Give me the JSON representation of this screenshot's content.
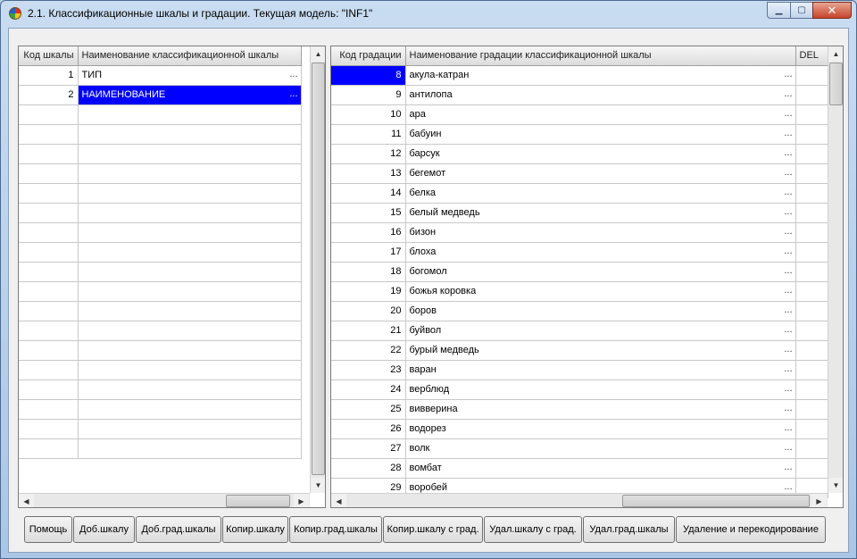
{
  "window": {
    "title": "2.1. Классификационные шкалы и градации. Текущая модель: \"INF1\"",
    "controls": {
      "minimize": "▁",
      "maximize": "▢",
      "close": "✕"
    }
  },
  "left_table": {
    "columns": [
      "Код шкалы",
      "Наименование классификационной шкалы"
    ],
    "rows": [
      {
        "code": "1",
        "name": "ТИП",
        "selected": false
      },
      {
        "code": "2",
        "name": "НАИМЕНОВАНИЕ",
        "selected": true
      }
    ],
    "total_visible_rows": 20
  },
  "right_table": {
    "columns": [
      "Код градации",
      "Наименование градации классификационной шкалы",
      "DEL"
    ],
    "rows": [
      {
        "code": "8",
        "name": "акула-катран"
      },
      {
        "code": "9",
        "name": "антилопа"
      },
      {
        "code": "10",
        "name": "ара"
      },
      {
        "code": "11",
        "name": "бабуин"
      },
      {
        "code": "12",
        "name": "барсук"
      },
      {
        "code": "13",
        "name": "бегемот"
      },
      {
        "code": "14",
        "name": "белка"
      },
      {
        "code": "15",
        "name": "белый медведь"
      },
      {
        "code": "16",
        "name": "бизон"
      },
      {
        "code": "17",
        "name": "блоха"
      },
      {
        "code": "18",
        "name": "богомол"
      },
      {
        "code": "19",
        "name": "божья коровка"
      },
      {
        "code": "20",
        "name": "боров"
      },
      {
        "code": "21",
        "name": "буйвол"
      },
      {
        "code": "22",
        "name": "бурый медведь"
      },
      {
        "code": "23",
        "name": "варан"
      },
      {
        "code": "24",
        "name": "верблюд"
      },
      {
        "code": "25",
        "name": "вивверина"
      },
      {
        "code": "26",
        "name": "водорез"
      },
      {
        "code": "27",
        "name": "волк"
      },
      {
        "code": "28",
        "name": "вомбат"
      },
      {
        "code": "29",
        "name": "воробей"
      }
    ],
    "selected_code": "8"
  },
  "ellipsis": "...",
  "buttons": [
    "Помощь",
    "Доб.шкалу",
    "Доб.град.шкалы",
    "Копир.шкалу",
    "Копир.град.шкалы",
    "Копир.шкалу с град.",
    "Удал.шкалу с град.",
    "Удал.град.шкалы",
    "Удаление и перекодирование"
  ],
  "colors": {
    "selection": "#0000ff",
    "selection_text": "#ffffff"
  }
}
